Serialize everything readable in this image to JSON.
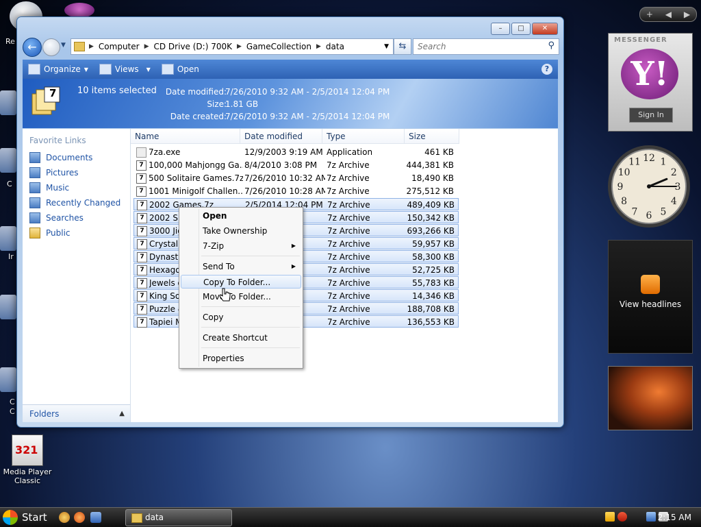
{
  "desktop": {
    "edge_labels": [
      "Re",
      "C",
      "Ir",
      "C",
      "C",
      "C"
    ],
    "media_player": {
      "label_line1": "Media Player",
      "label_line2": "Classic",
      "badge": "321"
    }
  },
  "window": {
    "controls": {
      "minimize": "–",
      "maximize": "□",
      "close": "✕"
    },
    "nav": {
      "back": "←"
    },
    "address": {
      "segments": [
        "Computer",
        "CD Drive (D:) 700K",
        "GameCollection",
        "data"
      ]
    },
    "search": {
      "placeholder": "Search"
    },
    "toolbar": {
      "organize": "Organize",
      "views": "Views",
      "open": "Open",
      "help": "?"
    },
    "details": {
      "icon_badge": "7",
      "selected": "10 items selected",
      "modified_label": "Date modified:",
      "modified_value": "7/26/2010 9:32 AM - 2/5/2014 12:04 PM",
      "size_label": "Size:",
      "size_value": "1.81 GB",
      "created_label": "Date created:",
      "created_value": "7/26/2010 9:32 AM - 2/5/2014 12:04 PM"
    },
    "navpane": {
      "title": "Favorite Links",
      "links": [
        "Documents",
        "Pictures",
        "Music",
        "Recently Changed",
        "Searches",
        "Public"
      ],
      "folders": "Folders"
    },
    "columns": [
      "Name",
      "Date modified",
      "Type",
      "Size"
    ],
    "files": [
      {
        "name": "7za.exe",
        "date": "12/9/2003 9:19 AM",
        "type": "Application",
        "size": "461 KB",
        "selected": false
      },
      {
        "name": "100,000 Mahjongg Ga...",
        "date": "8/4/2010 3:08 PM",
        "type": "7z Archive",
        "size": "444,381 KB",
        "selected": false
      },
      {
        "name": "500 Solitaire Games.7z",
        "date": "7/26/2010 10:32 AM",
        "type": "7z Archive",
        "size": "18,490 KB",
        "selected": false
      },
      {
        "name": "1001 Minigolf Challen...",
        "date": "7/26/2010 10:28 AM",
        "type": "7z Archive",
        "size": "275,512 KB",
        "selected": false
      },
      {
        "name": "2002 Games.7z",
        "date": "2/5/2014 12:04 PM",
        "type": "7z Archive",
        "size": "489,409 KB",
        "selected": true
      },
      {
        "name": "2002 Spa",
        "date": "AM",
        "type": "7z Archive",
        "size": "150,342 KB",
        "selected": true
      },
      {
        "name": "3000 Jigs",
        "date": "AM",
        "type": "7z Archive",
        "size": "693,266 KB",
        "selected": true
      },
      {
        "name": "Crystal C",
        "date": "AM",
        "type": "7z Archive",
        "size": "59,957 KB",
        "selected": true
      },
      {
        "name": "Dynasty",
        "date": "AM",
        "type": "7z Archive",
        "size": "58,300 KB",
        "selected": true
      },
      {
        "name": "Hexagor",
        "date": "AM",
        "type": "7z Archive",
        "size": "52,725 KB",
        "selected": true
      },
      {
        "name": "Jewels o",
        "date": "AM",
        "type": "7z Archive",
        "size": "55,783 KB",
        "selected": true
      },
      {
        "name": "King Sol",
        "date": "AM",
        "type": "7z Archive",
        "size": "14,346 KB",
        "selected": true
      },
      {
        "name": "Puzzle &",
        "date": "AM",
        "type": "7z Archive",
        "size": "188,708 KB",
        "selected": true
      },
      {
        "name": "Tapiei M",
        "date": "AM",
        "type": "7z Archive",
        "size": "136,553 KB",
        "selected": true
      }
    ]
  },
  "context_menu": {
    "items": [
      "Open",
      "Take Ownership",
      "7-Zip",
      "Send To",
      "Copy To Folder...",
      "Move To Folder...",
      "Copy",
      "Create Shortcut",
      "Properties"
    ],
    "submenu_arrow": "▶",
    "highlighted": "Copy To Folder..."
  },
  "gadgets": {
    "controls": [
      "+",
      "◀",
      "▶"
    ],
    "messenger": {
      "title": "MESSENGER",
      "logo": "Y!",
      "sign_in": "Sign In"
    },
    "clock": {
      "numbers": [
        "12",
        "1",
        "2",
        "3",
        "4",
        "5",
        "6",
        "7",
        "8",
        "9",
        "10",
        "11"
      ],
      "hour": 2,
      "minute": 15
    },
    "feed": {
      "label": "View headlines"
    }
  },
  "taskbar": {
    "start": "Start",
    "task": "data",
    "time": "2:15 AM"
  },
  "colors": {
    "accent": "#2e62b4",
    "selection": "#d6e5fa",
    "link": "#1f53a5"
  }
}
